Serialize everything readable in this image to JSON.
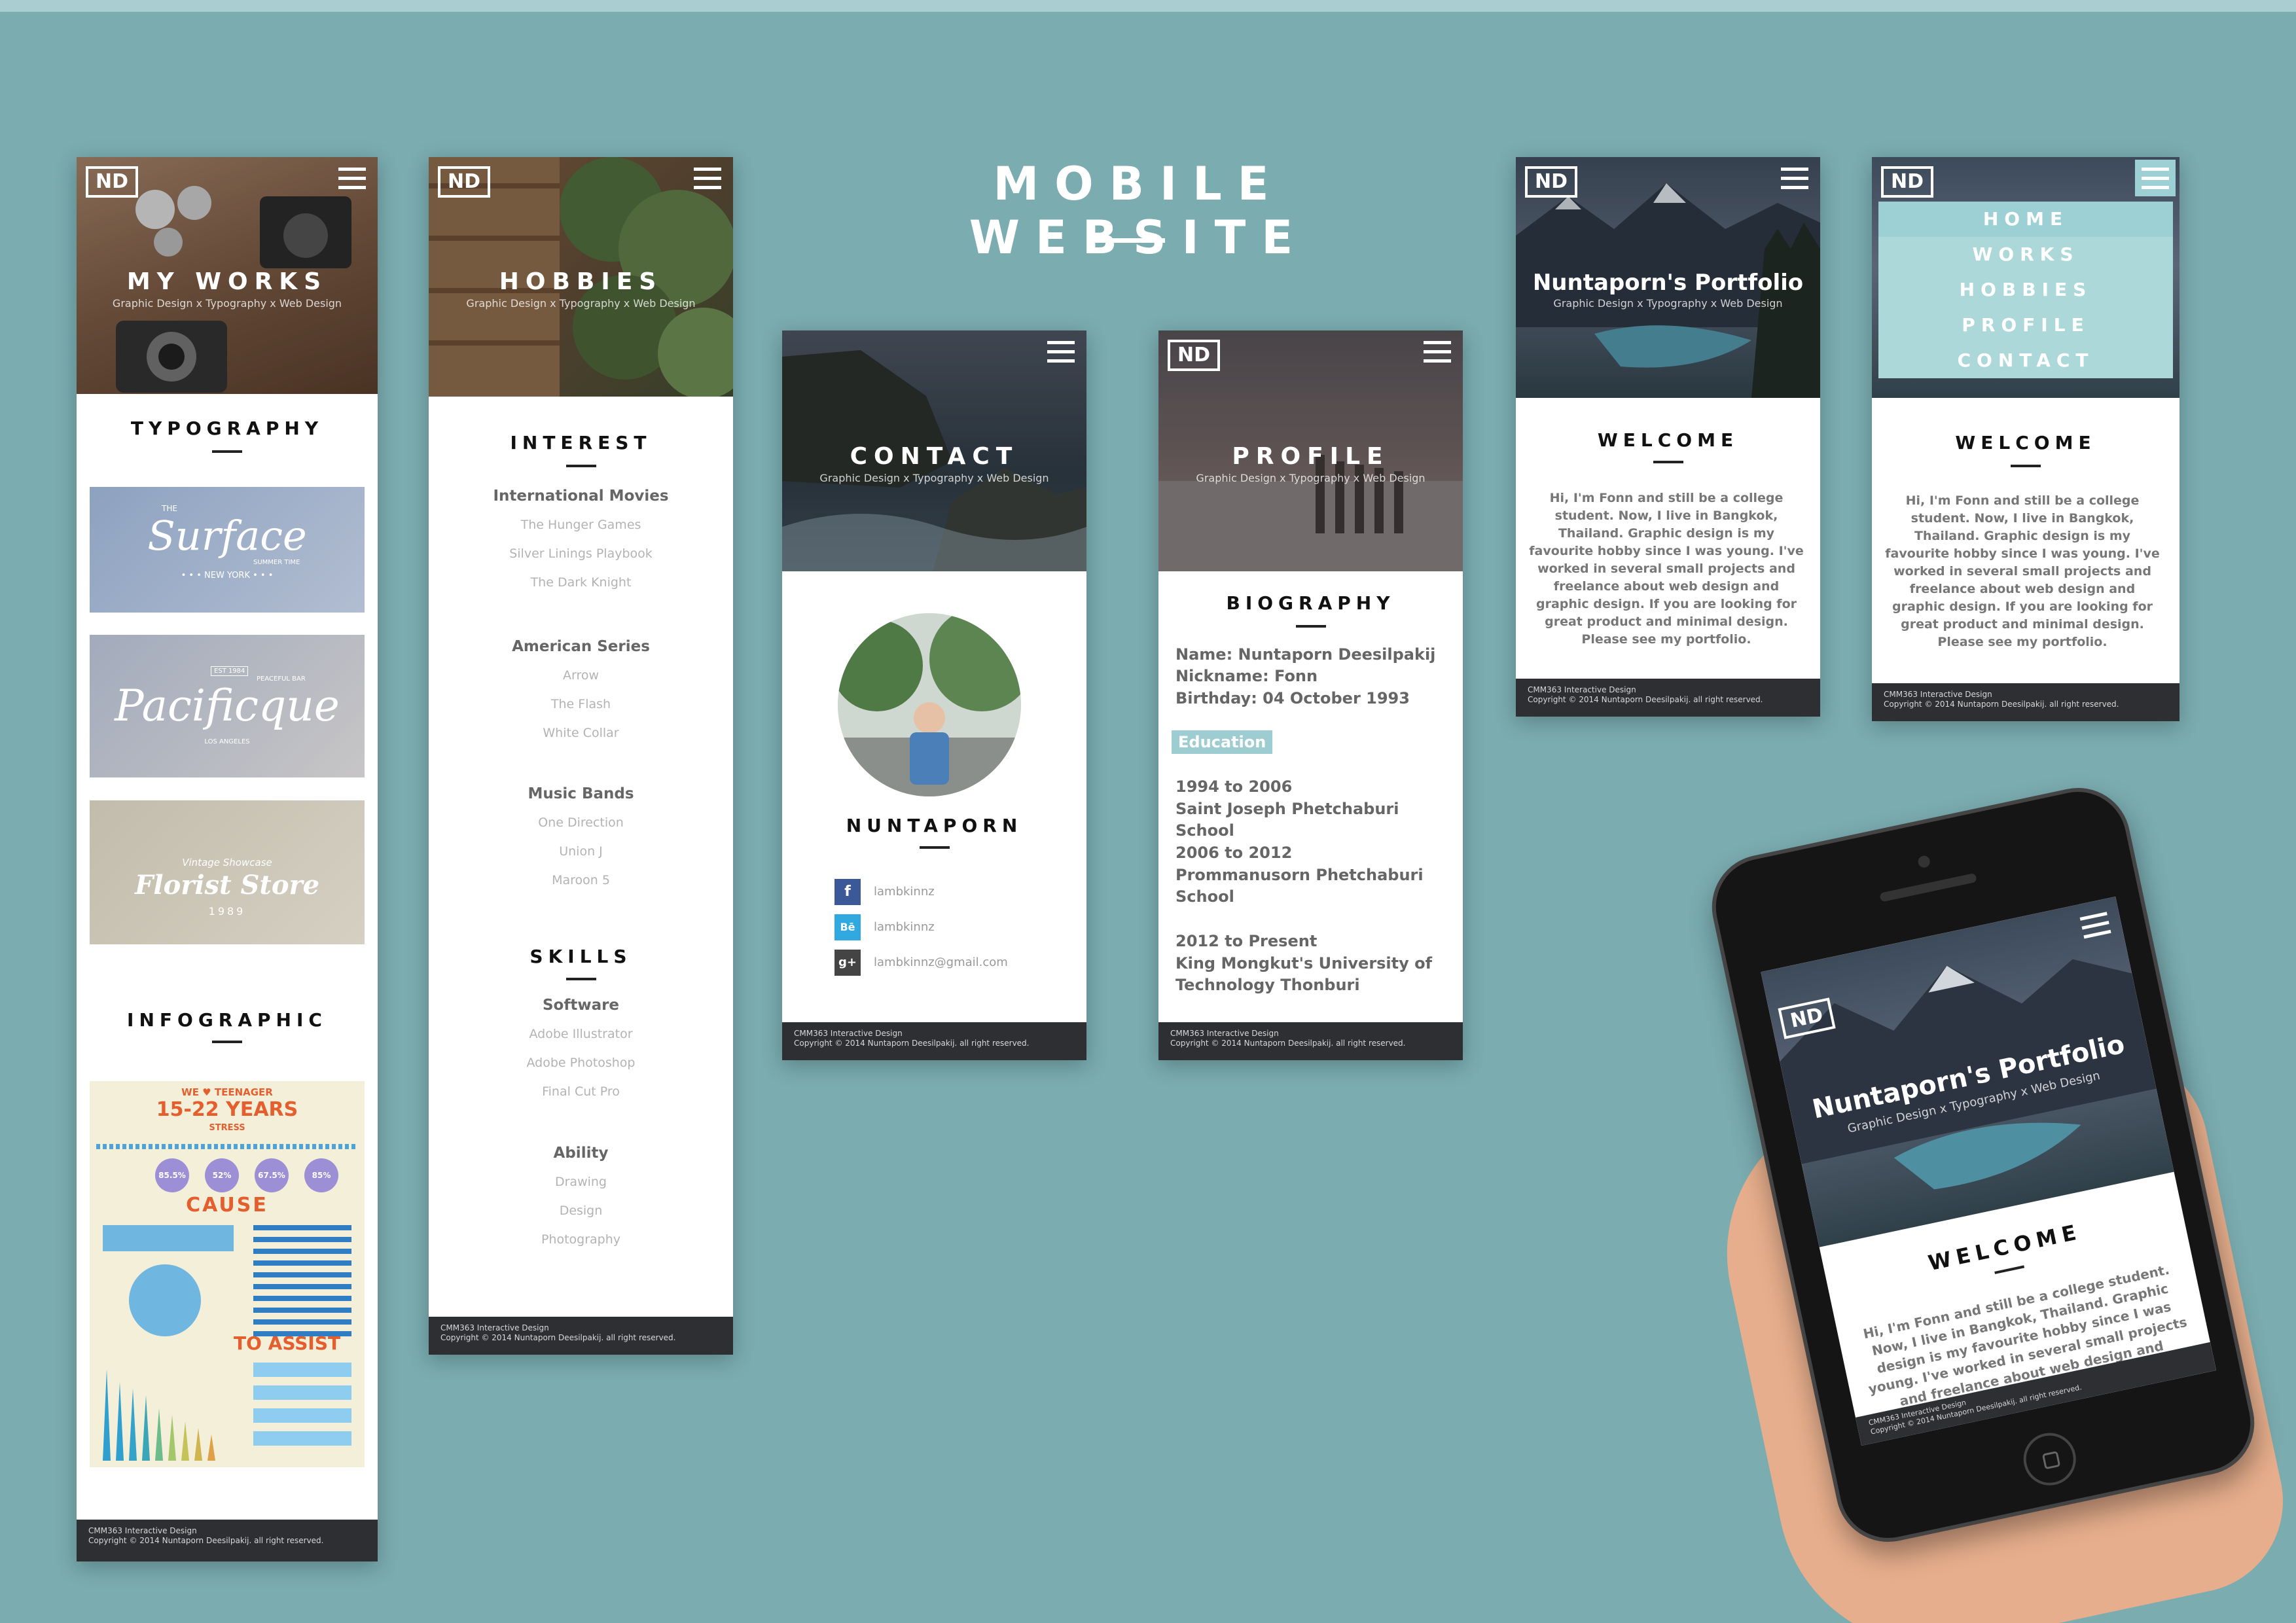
{
  "page": {
    "title": "MOBILE WEBSITE",
    "background": "#7aacb0"
  },
  "common": {
    "logo": "ND",
    "footer_line1": "CMM363 Interactive Design",
    "footer_line2": "Copyright © 2014 Nuntaporn Deesilpakij. all right reserved.",
    "subtitle": "Graphic Design x Typography x Web Design"
  },
  "works": {
    "hero_title": "MY WORKS",
    "section1": "TYPOGRAPHY",
    "thumbs": [
      {
        "small": "THE",
        "name": "Surface",
        "tag": "SUMMER TIME",
        "sub": "• • • NEW YORK • • •"
      },
      {
        "small": "EST 1984",
        "name": "Pacificque",
        "tag": "PEACEFUL BAR",
        "sub": "LOS ANGELES"
      },
      {
        "small": "Vintage Showcase",
        "name": "Florist Store",
        "sub": "1989"
      }
    ],
    "section2": "INFOGRAPHIC",
    "infographic": {
      "title1": "WE ♥ TEENAGER",
      "title2": "15-22 YEARS",
      "title3": "STRESS",
      "stats": [
        "85.5%",
        "52%",
        "67.5%",
        "85%"
      ],
      "cause": "CAUSE",
      "assist": "TO ASSIST"
    }
  },
  "hobbies": {
    "hero_title": "HOBBIES",
    "section1": "INTEREST",
    "groups": [
      {
        "head": "International Movies",
        "items": [
          "The Hunger Games",
          "Silver Linings Playbook",
          "The Dark Knight"
        ]
      },
      {
        "head": "American Series",
        "items": [
          "Arrow",
          "The Flash",
          "White Collar"
        ]
      },
      {
        "head": "Music Bands",
        "items": [
          "One Direction",
          "Union J",
          "Maroon 5"
        ]
      }
    ],
    "section2": "SKILLS",
    "skills": [
      {
        "head": "Software",
        "items": [
          "Adobe Illustrator",
          "Adobe Photoshop",
          "Final Cut Pro"
        ]
      },
      {
        "head": "Ability",
        "items": [
          "Drawing",
          "Design",
          "Photography"
        ]
      }
    ]
  },
  "contact": {
    "hero_title": "CONTACT",
    "name": "NUNTAPORN",
    "socials": [
      {
        "icon": "facebook-icon",
        "glyph": "f",
        "color": "#3b5998",
        "label": "lambkinnz"
      },
      {
        "icon": "behance-icon",
        "glyph": "Bē",
        "color": "#2fa9e0",
        "label": "lambkinnz"
      },
      {
        "icon": "google-plus-icon",
        "glyph": "g+",
        "color": "#444444",
        "label": "lambkinnz@gmail.com"
      }
    ]
  },
  "profile": {
    "hero_title": "PROFILE",
    "section": "BIOGRAPHY",
    "name": "Name:  Nuntaporn  Deesilpakij",
    "nickname": "Nickname:  Fonn",
    "birthday": "Birthday:  04 October 1993",
    "education_tag": "Education",
    "edu": [
      {
        "years": "1994 to 2006",
        "school": "Saint Joseph Phetchaburi School"
      },
      {
        "years": "2006 to 2012",
        "school": "Prommanusorn Phetchaburi School"
      },
      {
        "years": "2012 to Present",
        "school": "King Mongkut's University of Technology Thonburi"
      }
    ]
  },
  "portfolio": {
    "hero_title": "Nuntaporn's Portfolio",
    "section": "WELCOME",
    "text": "Hi, I'm Fonn and still be a college student. Now, I live in Bangkok, Thailand. Graphic design is my favourite hobby since I was young. I've worked in several small projects and freelance about web design and graphic design. If you are looking for great product and minimal design. Please see my portfolio."
  },
  "menu": {
    "items": [
      "HOME",
      "WORKS",
      "HOBBIES",
      "PROFILE",
      "CONTACT"
    ],
    "bg1": "#9cd0d4",
    "bg2": "#add8da"
  },
  "colors": {
    "footer": "#2e2f33",
    "accent": "#9dcdd0"
  }
}
